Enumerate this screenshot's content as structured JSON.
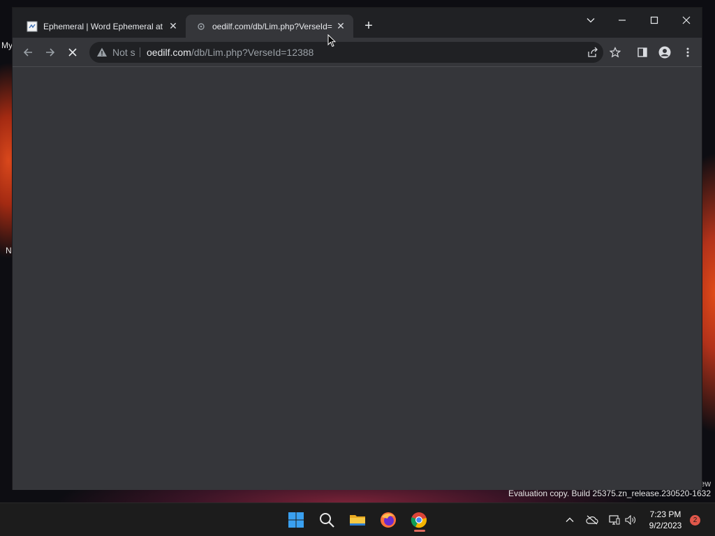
{
  "desktop": {
    "left_labels": [
      "My",
      "N"
    ],
    "watermark": {
      "line1": "ew",
      "line2": "Evaluation copy. Build 25375.zn_release.230520-1632"
    }
  },
  "browser": {
    "tabs": [
      {
        "title": "Ephemeral | Word Ephemeral at C",
        "favicon": "document-icon",
        "active": false
      },
      {
        "title": "oedilf.com/db/Lim.php?VerseId=",
        "favicon": "loading-globe-icon",
        "active": true
      }
    ],
    "new_tab_label": "+",
    "window_controls": [
      "tab-search",
      "minimize",
      "maximize",
      "close"
    ],
    "address_bar": {
      "security_label": "Not s",
      "url_host": "oedilf.com",
      "url_path": "/db/Lim.php?VerseId=12388"
    },
    "loading": true
  },
  "taskbar": {
    "apps": [
      "windows-start",
      "search",
      "file-explorer",
      "firefox",
      "chrome"
    ],
    "active_app": "chrome",
    "clock": {
      "time": "7:23 PM",
      "date": "9/2/2023"
    },
    "notification_count": "2"
  }
}
